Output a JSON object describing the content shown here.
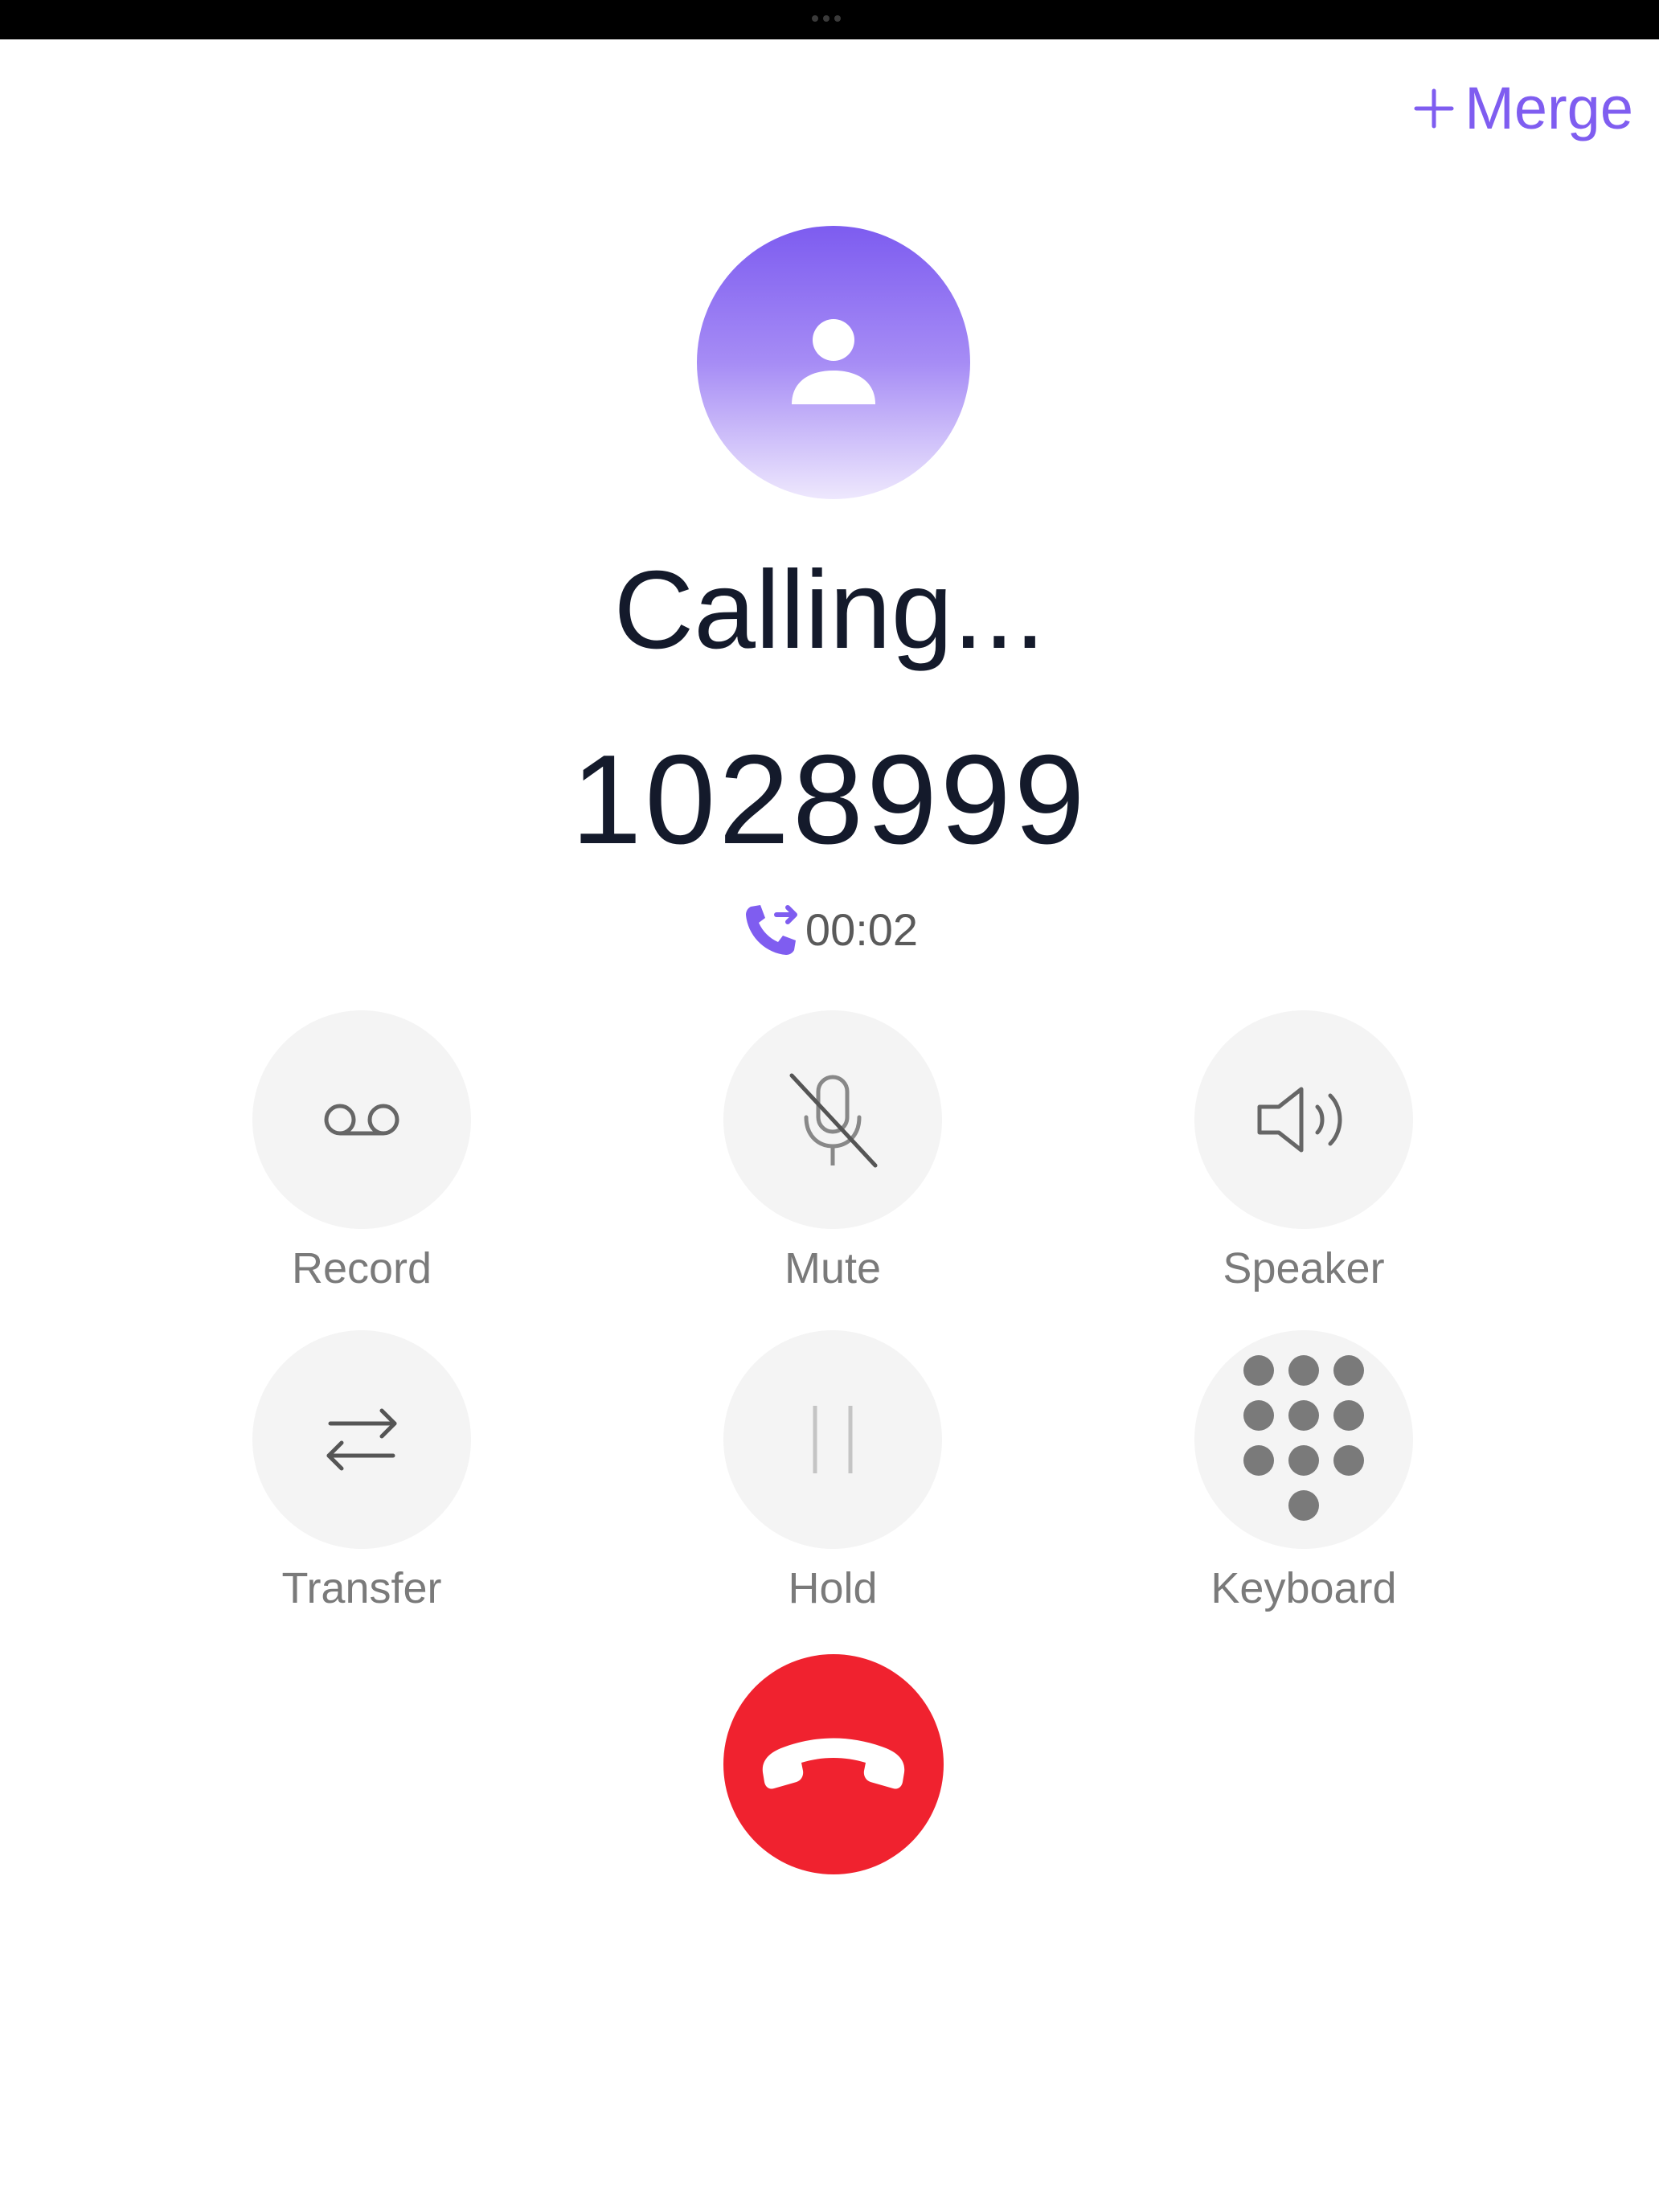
{
  "header": {
    "merge_label": "Merge"
  },
  "call": {
    "status": "Calling...",
    "number": "1028999",
    "duration": "00:02"
  },
  "controls": [
    {
      "label": "Record",
      "icon": "voicemail-icon"
    },
    {
      "label": "Mute",
      "icon": "mic-off-icon"
    },
    {
      "label": "Speaker",
      "icon": "speaker-icon"
    },
    {
      "label": "Transfer",
      "icon": "transfer-arrows-icon"
    },
    {
      "label": "Hold",
      "icon": "pause-icon"
    },
    {
      "label": "Keyboard",
      "icon": "keypad-icon"
    }
  ],
  "end_call": {
    "icon": "hang-up-icon"
  },
  "colors": {
    "accent": "#7f5df0",
    "end_call": "#f0222f",
    "text_primary": "#141a2b",
    "text_secondary": "#7a7a7a",
    "button_bg": "#f4f4f4"
  }
}
